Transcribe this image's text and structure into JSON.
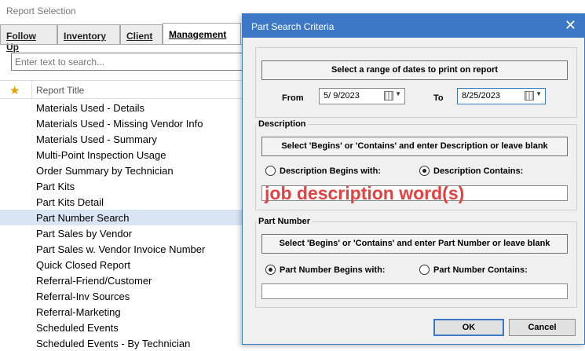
{
  "report_window": {
    "title": "Report Selection",
    "tabs": [
      {
        "label": "Follow Up"
      },
      {
        "label": "Inventory"
      },
      {
        "label": "Client"
      },
      {
        "label": "Management"
      }
    ],
    "search_placeholder": "Enter text to search...",
    "column_header": "Report Title",
    "items": [
      "Materials Used - Details",
      "Materials Used - Missing Vendor Info",
      "Materials Used - Summary",
      "Multi-Point Inspection Usage",
      "Order Summary by Technician",
      "Part Kits",
      "Part Kits Detail",
      "Part Number Search",
      "Part Sales by Vendor",
      "Part Sales w. Vendor Invoice Number",
      "Quick Closed Report",
      "Referral-Friend/Customer",
      "Referral-Inv Sources",
      "Referral-Marketing",
      "Scheduled Events",
      "Scheduled Events - By Technician"
    ],
    "selected_item": "Part Number Search"
  },
  "dialog": {
    "title": "Part Search Criteria",
    "close_icon": "close-icon",
    "dates": {
      "heading": "Select a range of dates to print on report",
      "from_label": "From",
      "from_value": "5/  9/2023",
      "to_label": "To",
      "to_value": "8/25/2023"
    },
    "description": {
      "group_label": "Description",
      "heading": "Select 'Begins' or 'Contains' and enter Description or leave blank",
      "begins_label": "Description Begins with:",
      "contains_label": "Description Contains:",
      "selected": "contains",
      "annotation": "job description word(s)"
    },
    "part_number": {
      "group_label": "Part Number",
      "heading": "Select 'Begins' or 'Contains' and enter Part Number or leave blank",
      "begins_label": "Part Number Begins with:",
      "contains_label": "Part Number Contains:",
      "selected": "begins"
    },
    "ok_label": "OK",
    "cancel_label": "Cancel"
  },
  "colors": {
    "accent": "#3c78c5",
    "selection": "#d9e4f5",
    "annotation": "#e84040"
  }
}
